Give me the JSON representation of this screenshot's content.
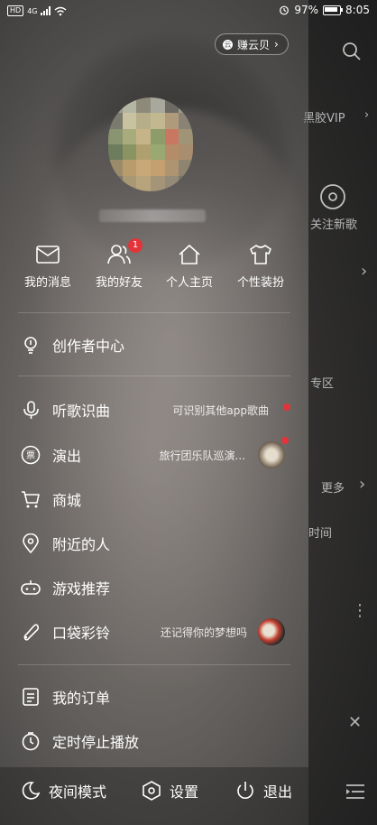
{
  "status_bar": {
    "network": "4G",
    "battery": "97%",
    "time": "8:05"
  },
  "header": {
    "cloud_label": "赚云贝"
  },
  "quick_actions": [
    {
      "label": "我的消息",
      "icon": "mail-icon"
    },
    {
      "label": "我的好友",
      "icon": "friends-icon",
      "badge": "1"
    },
    {
      "label": "个人主页",
      "icon": "home-icon"
    },
    {
      "label": "个性装扮",
      "icon": "shirt-icon"
    }
  ],
  "menu": {
    "creator": "创作者中心",
    "song_recognition": {
      "label": "听歌识曲",
      "hint": "可识别其他app歌曲"
    },
    "shows": {
      "label": "演出",
      "hint": "旅行团乐队巡演..."
    },
    "store": "商城",
    "nearby": "附近的人",
    "games": "游戏推荐",
    "ringtone": {
      "label": "口袋彩铃",
      "hint": "还记得你的梦想吗"
    },
    "orders": "我的订单",
    "timer": "定时停止播放"
  },
  "bottom": {
    "night_mode": "夜间模式",
    "settings": "设置",
    "logout": "退出"
  },
  "background_panel": {
    "vip": "黑胶VIP",
    "new_songs": "关注新歌",
    "zone": "专区",
    "more": "更多",
    "time": "时间"
  },
  "colors": {
    "badge": "#e3343a",
    "divider": "rgba(255,255,255,0.18)"
  }
}
